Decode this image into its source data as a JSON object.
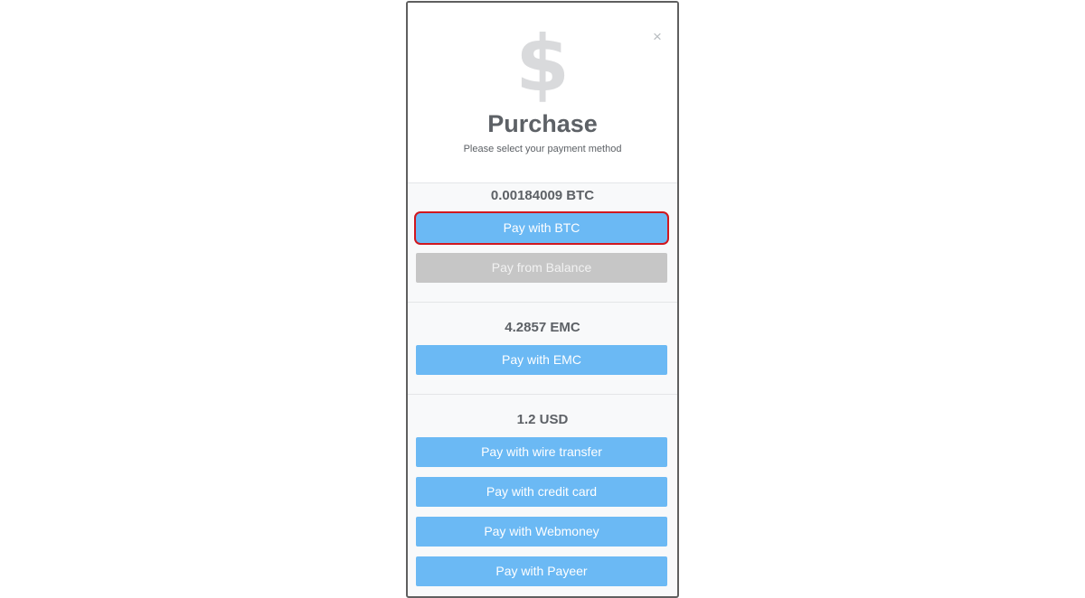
{
  "modal": {
    "close_glyph": "×",
    "icon_glyph": "$",
    "title": "Purchase",
    "subtitle": "Please select your payment method"
  },
  "sections": [
    {
      "amount": "0.00184009 BTC",
      "buttons": [
        {
          "label": "Pay with BTC",
          "state": "enabled",
          "highlighted": true
        },
        {
          "label": "Pay from Balance",
          "state": "disabled"
        }
      ]
    },
    {
      "amount": "4.2857 EMC",
      "buttons": [
        {
          "label": "Pay with EMC",
          "state": "enabled"
        }
      ]
    },
    {
      "amount": "1.2 USD",
      "buttons": [
        {
          "label": "Pay with wire transfer",
          "state": "enabled"
        },
        {
          "label": "Pay with credit card",
          "state": "enabled"
        },
        {
          "label": "Pay with Webmoney",
          "state": "enabled"
        },
        {
          "label": "Pay with Payeer",
          "state": "enabled"
        }
      ]
    }
  ],
  "colors": {
    "button_primary": "#6bb9f4",
    "button_disabled": "#c6c6c6",
    "highlight_outline": "#d0181f",
    "text": "#5d6166",
    "icon": "#d9dadc"
  },
  "icons": {
    "close": "close-icon",
    "header": "dollar-icon"
  }
}
